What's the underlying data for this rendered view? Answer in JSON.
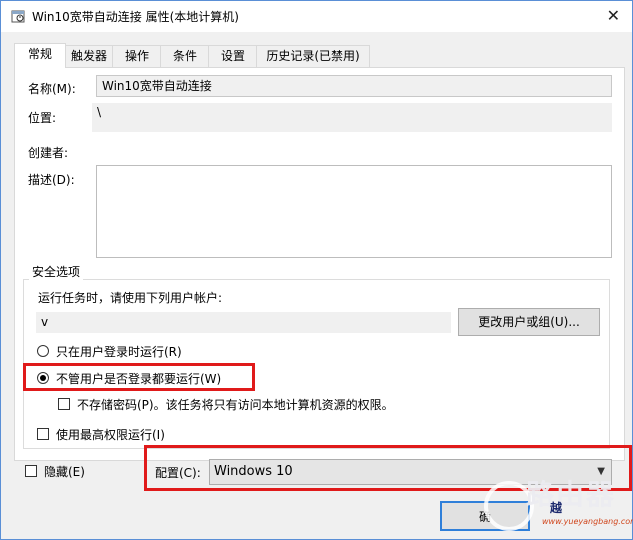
{
  "window": {
    "title": "Win10宽带自动连接 属性(本地计算机)",
    "close_glyph": "✕"
  },
  "tabs": [
    {
      "label": "常规"
    },
    {
      "label": "触发器"
    },
    {
      "label": "操作"
    },
    {
      "label": "条件"
    },
    {
      "label": "设置"
    },
    {
      "label": "历史记录(已禁用)"
    }
  ],
  "general": {
    "name_label": "名称(M):",
    "name_value": "Win10宽带自动连接",
    "location_label": "位置:",
    "location_value": "\\",
    "author_label": "创建者:",
    "description_label": "描述(D):",
    "description_value": ""
  },
  "security": {
    "group_title": "安全选项",
    "run_as_prompt": "运行任务时，请使用下列用户帐户:",
    "user_account": "v",
    "change_user_button": "更改用户或组(U)...",
    "radio_logged_on": "只在用户登录时运行(R)",
    "radio_whether_logged_on": "不管用户是否登录都要运行(W)",
    "radio_selected": "whether_logged_on",
    "no_store_password": "不存储密码(P)。该任务将只有访问本地计算机资源的权限。",
    "highest_privileges": "使用最高权限运行(I)"
  },
  "footer": {
    "hidden_label": "隐藏(E)",
    "config_label": "配置(C):",
    "config_value": "Windows 10",
    "ok_partial": "确"
  },
  "watermark": {
    "big": "路由器",
    "name": "越",
    "url": "www.yueyangbang.com"
  },
  "colors": {
    "highlight_box": "#e01a1a",
    "window_border": "#5a8fd6"
  }
}
